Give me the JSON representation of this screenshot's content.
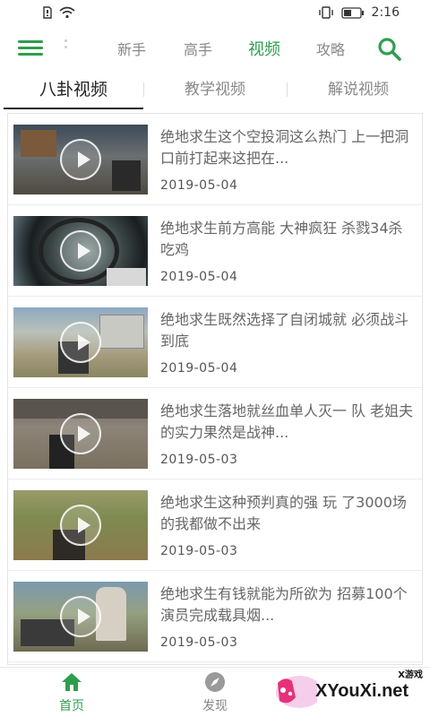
{
  "status_bar": {
    "time": "2:16",
    "icons": [
      "sim-icon",
      "wifi-icon",
      "vibrate-icon",
      "battery-icon"
    ]
  },
  "top_nav": {
    "tabs": [
      {
        "label": "新手"
      },
      {
        "label": "高手"
      },
      {
        "label": "视频"
      },
      {
        "label": "攻略"
      }
    ],
    "active_tab": "视频",
    "accent_color": "#2e9e4e"
  },
  "sub_tabs": {
    "items": [
      {
        "label": "八卦视频"
      },
      {
        "label": "教学视频"
      },
      {
        "label": "解说视频"
      }
    ],
    "active": "八卦视频"
  },
  "videos": [
    {
      "title": "绝地求生这个空投洞这么热门 上一把洞口前打起来这把在...",
      "date": "2019-05-04"
    },
    {
      "title": "绝地求生前方高能 大神疯狂 杀戮34杀吃鸡",
      "date": "2019-05-04"
    },
    {
      "title": "绝地求生既然选择了自闭城就 必须战斗到底",
      "date": "2019-05-04"
    },
    {
      "title": "绝地求生落地就丝血单人灭一 队 老姐夫的实力果然是战神...",
      "date": "2019-05-03"
    },
    {
      "title": "绝地求生这种预判真的强 玩 了3000场的我都做不出来",
      "date": "2019-05-03"
    },
    {
      "title": "绝地求生有钱就能为所欲为 招募100个演员完成载具烟...",
      "date": "2019-05-03"
    }
  ],
  "bottom_nav": {
    "items": [
      {
        "label": "首页",
        "icon": "home-icon"
      },
      {
        "label": "发现",
        "icon": "compass-icon"
      }
    ],
    "active": "首页"
  },
  "watermark": {
    "text": "XYouXi.net",
    "small": "X游戏"
  }
}
